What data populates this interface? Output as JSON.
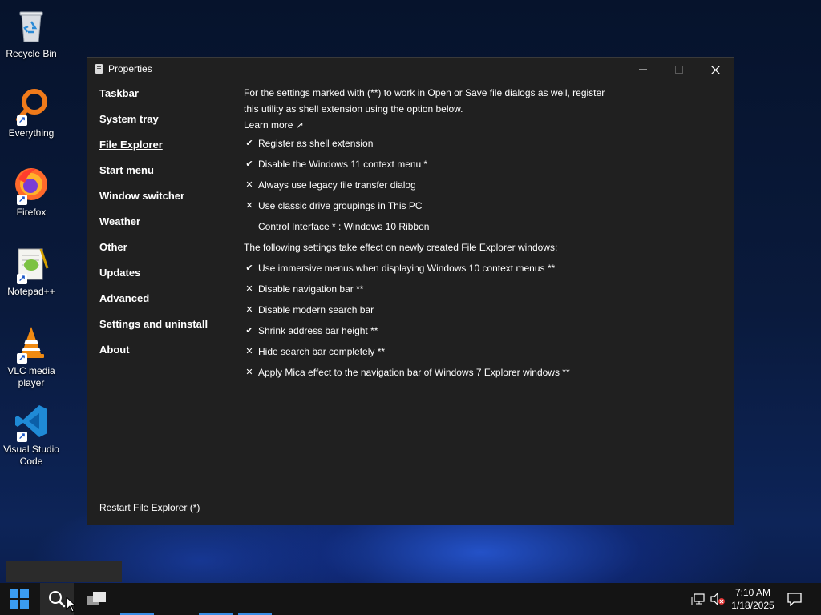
{
  "desktop": {
    "icons": [
      {
        "label": "Recycle Bin",
        "icon": "recycle-bin-icon"
      },
      {
        "label": "Everything",
        "icon": "everything-search-icon"
      },
      {
        "label": "Firefox",
        "icon": "firefox-icon"
      },
      {
        "label": "Notepad++",
        "icon": "notepad-plus-plus-icon"
      },
      {
        "label": "VLC media player",
        "icon": "vlc-icon"
      },
      {
        "label": "Visual Studio Code",
        "icon": "vscode-icon"
      }
    ]
  },
  "window": {
    "title": "Properties",
    "nav": [
      "Taskbar",
      "System tray",
      "File Explorer",
      "Start menu",
      "Window switcher",
      "Weather",
      "Other",
      "Updates",
      "Advanced",
      "Settings and uninstall",
      "About"
    ],
    "active_nav": "File Explorer",
    "intro": "For the settings marked with (**) to work in Open or Save file dialogs as well, register this utility as shell extension using the option below.",
    "learn_more": "Learn more ↗",
    "options": [
      {
        "mark": "✔",
        "label": "Register as shell extension",
        "checked": true
      },
      {
        "mark": "✔",
        "label": "Disable the Windows 11 context menu *",
        "checked": true
      },
      {
        "mark": "✕",
        "label": "Always use legacy file transfer dialog",
        "checked": false
      },
      {
        "mark": "✕",
        "label": "Use classic drive groupings in This PC",
        "checked": false
      }
    ],
    "control_interface": "Control Interface * : Windows 10 Ribbon",
    "section_heading": "The following settings take effect on newly created File Explorer windows:",
    "options2": [
      {
        "mark": "✔",
        "label": "Use immersive menus when displaying Windows 10 context menus **",
        "checked": true
      },
      {
        "mark": "✕",
        "label": "Disable navigation bar **",
        "checked": false
      },
      {
        "mark": "✕",
        "label": "Disable modern search bar",
        "checked": false
      },
      {
        "mark": "✔",
        "label": "Shrink address bar height **",
        "checked": true
      },
      {
        "mark": "✕",
        "label": "Hide search bar completely **",
        "checked": false
      },
      {
        "mark": "✕",
        "label": "Apply Mica effect to the navigation bar of Windows 7 Explorer windows **",
        "checked": false
      }
    ],
    "restart": "Restart File Explorer (*)"
  },
  "taskbar": {
    "time": "7:10 AM",
    "date": "1/18/2025"
  },
  "colors": {
    "window_bg": "#202020",
    "taskbar_bg": "#141414",
    "accent": "#3a8ee6"
  }
}
